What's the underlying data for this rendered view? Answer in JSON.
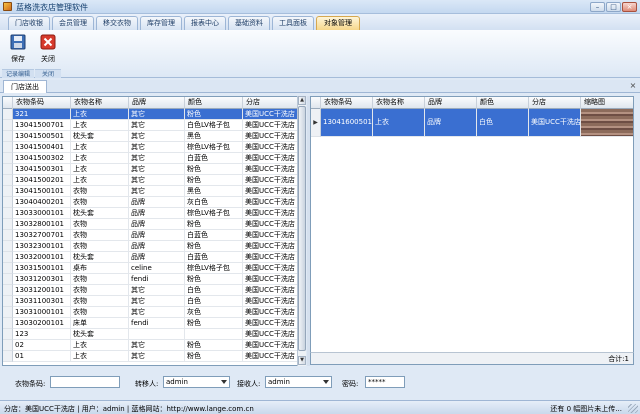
{
  "window": {
    "title": "蓝格洗衣店管理软件",
    "minimize_glyph": "–",
    "maximize_glyph": "□",
    "close_glyph": "×"
  },
  "menu_tabs": [
    "门店收银",
    "会员管理",
    "移交衣物",
    "库存管理",
    "报表中心",
    "基础资料",
    "工具面板",
    "对象管理"
  ],
  "active_menu_tab": "对象管理",
  "ribbon": {
    "save_label": "保存",
    "close_label": "关闭",
    "group_record": "记录编辑",
    "group_close": "关闭"
  },
  "doc_tab": {
    "label": "门店送出",
    "close_glyph": "×"
  },
  "left_grid": {
    "columns": [
      "衣物条码",
      "衣物名称",
      "品牌",
      "颜色",
      "分店"
    ],
    "rows": [
      [
        "321",
        "上衣",
        "其它",
        "粉色",
        "美国UCC干洗店"
      ],
      [
        "13041500701",
        "上衣",
        "其它",
        "白色LV格子包",
        "美国UCC干洗店"
      ],
      [
        "13041500501",
        "枕头套",
        "其它",
        "黑色",
        "美国UCC干洗店"
      ],
      [
        "13041500401",
        "上衣",
        "其它",
        "棕色LV格子包",
        "美国UCC干洗店"
      ],
      [
        "13041500302",
        "上衣",
        "其它",
        "白蓝色",
        "美国UCC干洗店"
      ],
      [
        "13041500301",
        "上衣",
        "其它",
        "粉色",
        "美国UCC干洗店"
      ],
      [
        "13041500201",
        "上衣",
        "其它",
        "粉色",
        "美国UCC干洗店"
      ],
      [
        "13041500101",
        "衣物",
        "其它",
        "黑色",
        "美国UCC干洗店"
      ],
      [
        "13040400201",
        "衣物",
        "品牌",
        "灰白色",
        "美国UCC干洗店"
      ],
      [
        "13033000101",
        "枕头套",
        "品牌",
        "棕色LV格子包",
        "美国UCC干洗店"
      ],
      [
        "13032800101",
        "衣物",
        "品牌",
        "粉色",
        "美国UCC干洗店"
      ],
      [
        "13032700701",
        "衣物",
        "品牌",
        "白蓝色",
        "美国UCC干洗店"
      ],
      [
        "13032300101",
        "衣物",
        "品牌",
        "粉色",
        "美国UCC干洗店"
      ],
      [
        "13032000101",
        "枕头套",
        "品牌",
        "白蓝色",
        "美国UCC干洗店"
      ],
      [
        "13031500101",
        "桌布",
        "celine",
        "棕色LV格子包",
        "美国UCC干洗店"
      ],
      [
        "13031200301",
        "衣物",
        "fendi",
        "粉色",
        "美国UCC干洗店"
      ],
      [
        "13031200101",
        "衣物",
        "其它",
        "白色",
        "美国UCC干洗店"
      ],
      [
        "13031100301",
        "衣物",
        "其它",
        "白色",
        "美国UCC干洗店"
      ],
      [
        "13031000101",
        "衣物",
        "其它",
        "灰色",
        "美国UCC干洗店"
      ],
      [
        "13030200101",
        "床单",
        "fendi",
        "粉色",
        "美国UCC干洗店"
      ],
      [
        "123",
        "枕头套",
        "",
        "",
        "美国UCC干洗店"
      ],
      [
        "02",
        "上衣",
        "其它",
        "粉色",
        "美国UCC干洗店"
      ],
      [
        "01",
        "上衣",
        "其它",
        "粉色",
        "美国UCC干洗店"
      ]
    ]
  },
  "right_grid": {
    "columns": [
      "衣物条码",
      "衣物名称",
      "品牌",
      "颜色",
      "分店",
      "缩略图"
    ],
    "rows": [
      [
        "13041600501",
        "上衣",
        "品牌",
        "白色",
        "美国UCC干洗店"
      ]
    ],
    "total_label": "合计:1"
  },
  "form": {
    "barcode_label": "衣物条码:",
    "barcode_value": "",
    "transfer_label": "转移人:",
    "transfer_value": "admin",
    "receiver_label": "接收人:",
    "receiver_value": "admin",
    "password_label": "密码:",
    "password_value": "*****"
  },
  "status": {
    "left": "分店：美国UCC干洗店 | 用户：admin | 蓝格网站：http://www.lange.com.cn",
    "right": "还有 0 幅图片未上传..."
  }
}
